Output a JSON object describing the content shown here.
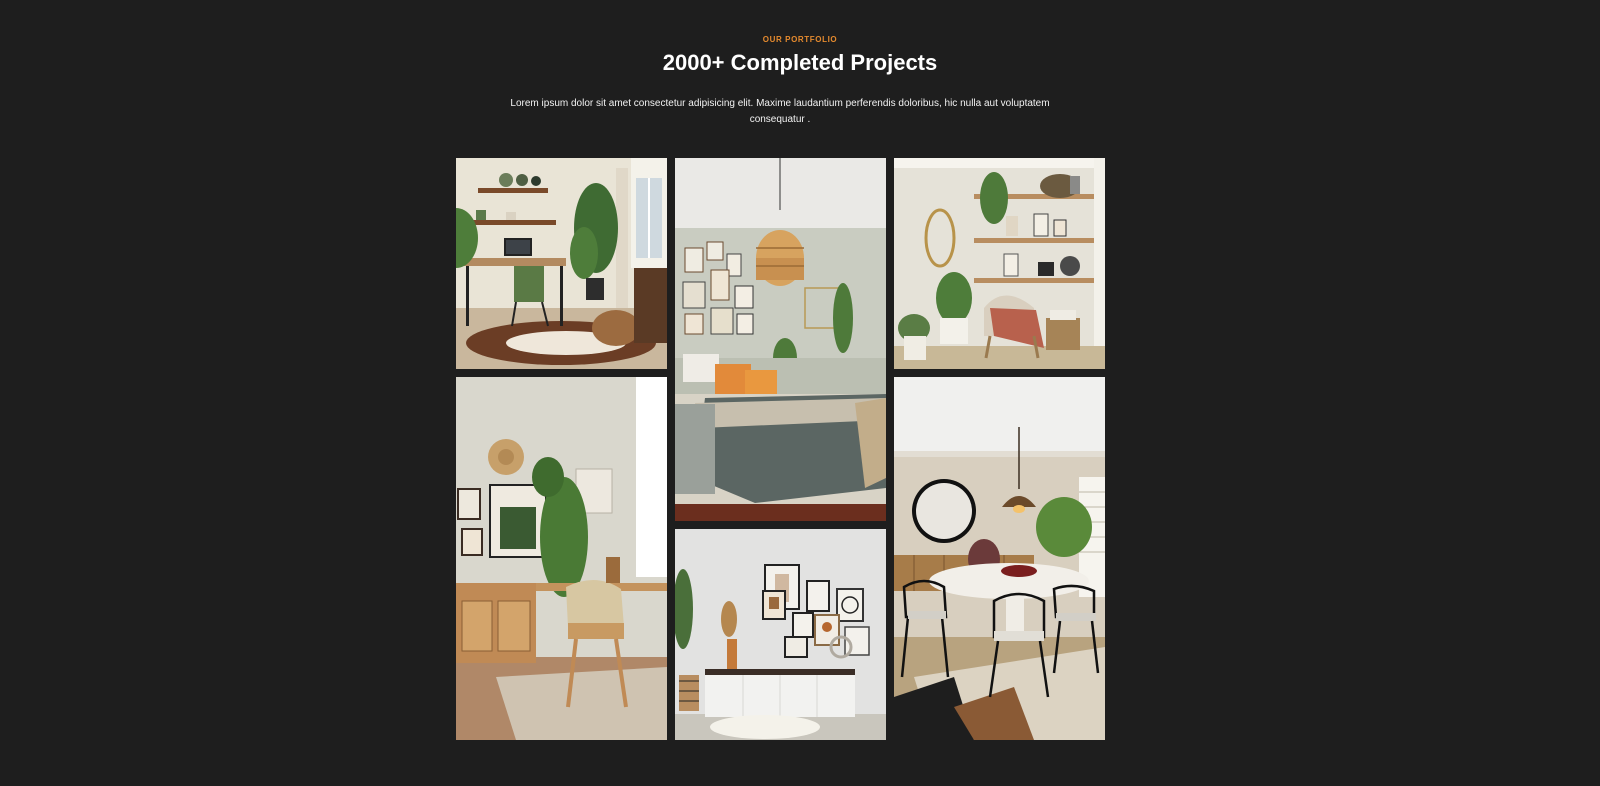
{
  "section": {
    "eyebrow": "OUR PORTFOLIO",
    "title": "2000+ Completed Projects",
    "description": "Lorem ipsum dolor sit amet consectetur adipisicing elit. Maxime laudantium perferendis doloribus, hic nulla aut voluptatem consequatur ."
  },
  "colors": {
    "background": "#1e1e1e",
    "accent": "#e58a2e",
    "heading": "#ffffff"
  },
  "gallery": {
    "images": [
      {
        "name": "home-office-photo"
      },
      {
        "name": "bedroom-photo"
      },
      {
        "name": "reading-nook-photo"
      },
      {
        "name": "study-corner-photo"
      },
      {
        "name": "gallery-wall-photo"
      },
      {
        "name": "dining-room-photo"
      }
    ]
  }
}
